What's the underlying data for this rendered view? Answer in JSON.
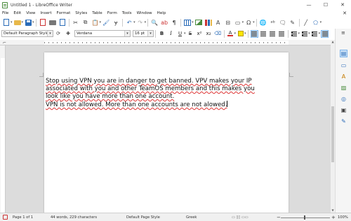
{
  "window": {
    "title": "Untitled 1 - LibreOffice Writer",
    "minimize_glyph": "—",
    "maximize_glyph": "☐",
    "close_glyph": "✕"
  },
  "menubar": {
    "items": [
      "File",
      "Edit",
      "View",
      "Insert",
      "Format",
      "Styles",
      "Table",
      "Form",
      "Tools",
      "Window",
      "Help"
    ],
    "close_glyph": "✕"
  },
  "toolbar": {
    "icons": [
      "new-document-icon",
      "open-folder-icon",
      "save-icon",
      "export-pdf-icon",
      "print-icon",
      "print-preview-icon",
      "cut-icon",
      "copy-icon",
      "paste-icon",
      "clone-formatting-icon",
      "clear-formatting-icon",
      "undo-icon",
      "redo-icon",
      "find-replace-icon",
      "spelling-icon",
      "formatting-marks-icon",
      "insert-table-icon",
      "insert-image-icon",
      "insert-chart-icon",
      "insert-textbox-icon",
      "page-break-icon",
      "insert-field-icon",
      "special-character-icon",
      "hyperlink-icon",
      "footnote-icon",
      "comment-icon",
      "track-changes-icon",
      "line-icon",
      "shapes-icon"
    ]
  },
  "formatting": {
    "paragraph_style": "Default Paragraph Style",
    "font_name": "Verdana",
    "font_size": "16 pt",
    "bold": "B",
    "italic": "I",
    "underline": "U",
    "strikethrough": "S",
    "superscript": "x²",
    "subscript": "x₂",
    "font_color_letter": "A",
    "highlight_color": "#ffe600",
    "font_color": "#d32f2f",
    "accent_color": "#2b6cb8"
  },
  "document": {
    "lines": [
      "Stop using VPN you are in danger to get banned. VPV makes your IP",
      "associated with you and other TeamOS members and this makes you",
      "look like you have more than one account.",
      "VPN is not allowed. More than one accounts are not alowed."
    ]
  },
  "statusbar": {
    "page": "Page 1 of 1",
    "words": "44 words, 229 characters",
    "page_style": "Default Page Style",
    "language": "Greek",
    "zoom_minus": "−",
    "zoom_plus": "+",
    "zoom": "100%"
  },
  "sidebar": {
    "menu_glyph": "≡",
    "icons": [
      "properties-icon",
      "page-icon",
      "styles-icon",
      "gallery-icon",
      "navigator-icon",
      "manage-changes-icon",
      "design-icon"
    ]
  }
}
